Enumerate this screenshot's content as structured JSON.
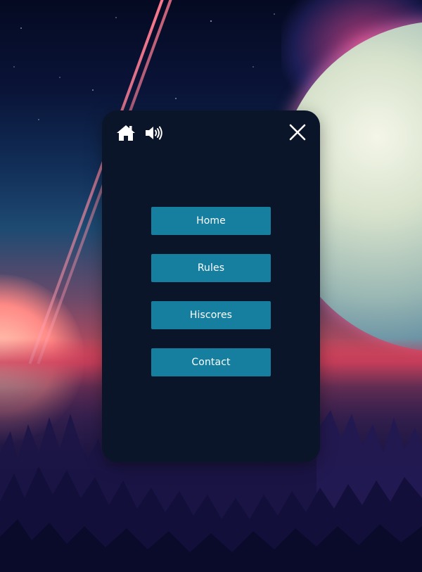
{
  "toolbar": {
    "home_icon": "home-icon",
    "sound_icon": "speaker-volume-icon",
    "close_icon": "close-icon"
  },
  "menu": {
    "items": [
      {
        "label": "Home"
      },
      {
        "label": "Rules"
      },
      {
        "label": "Hiscores"
      },
      {
        "label": "Contact"
      }
    ]
  },
  "colors": {
    "modal_background": "#0b1529",
    "button_background": "#167fa0",
    "button_text": "#ffffff",
    "icon_color": "#ffffff"
  }
}
